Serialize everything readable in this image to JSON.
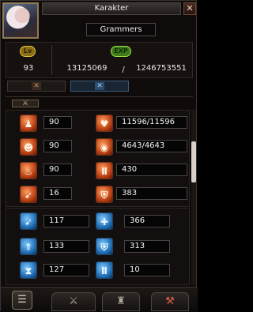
{
  "window": {
    "title": "Karakter",
    "close_glyph": "✕",
    "character_name": "Grammers"
  },
  "level": {
    "lv_badge": "Lv",
    "exp_badge": "EXP",
    "level_value": "93",
    "exp_current": "13125069",
    "separator": "/",
    "exp_max": "1246753551"
  },
  "tabs": [
    {
      "icon": "cross-swords-icon",
      "glyph": "✕"
    },
    {
      "icon": "cross-swords-blue-icon",
      "glyph": "✕"
    }
  ],
  "weapon_header": {
    "icon": "sword-icon",
    "glyph": "⚔"
  },
  "orange_stats": [
    {
      "left_icon": "strength-figure-icon",
      "left_glyph": "♟",
      "left_value": "90",
      "right_icon": "heart-hp-icon",
      "right_glyph": "♥",
      "right_value": "11596/11596"
    },
    {
      "left_icon": "head-intelligence-icon",
      "left_glyph": "☻",
      "left_value": "90",
      "right_icon": "orb-mp-icon",
      "right_glyph": "◉",
      "right_value": "4643/4643"
    },
    {
      "left_icon": "potion-icon",
      "left_glyph": "♨",
      "left_value": "90",
      "right_icon": "pillar-attack-icon",
      "right_glyph": "Ⅱ",
      "right_value": "430"
    },
    {
      "left_icon": "boot-agility-icon",
      "left_glyph": "➹",
      "left_value": "16",
      "right_icon": "shield-defense-icon",
      "right_glyph": "⛨",
      "right_value": "383"
    }
  ],
  "blue_stats": [
    {
      "left_icon": "speed-boot-icon",
      "left_glyph": "➹",
      "left_value": "117",
      "right_icon": "cross-hit-icon",
      "right_glyph": "✚",
      "right_value": "366"
    },
    {
      "left_icon": "arrows-up-icon",
      "left_glyph": "⇑",
      "left_value": "133",
      "right_icon": "shield-magic-icon",
      "right_glyph": "⛨",
      "right_value": "313"
    },
    {
      "left_icon": "hourglass-icon",
      "left_glyph": "⧗",
      "left_value": "127",
      "right_icon": "pillar-blue-icon",
      "right_glyph": "Ⅱ",
      "right_value": "10"
    }
  ],
  "bottom_tabs": [
    {
      "icon": "document-icon",
      "glyph": "☰"
    },
    {
      "icon": "sword-tab-icon",
      "glyph": "⚔"
    },
    {
      "icon": "helmet-tab-icon",
      "glyph": "♜"
    },
    {
      "icon": "skill-tab-icon",
      "glyph": "⚒"
    }
  ],
  "colors": {
    "orange_accent": "#d8602a",
    "blue_accent": "#3a8ad8",
    "gold_badge": "#e4c040",
    "exp_badge": "#9be04a"
  }
}
